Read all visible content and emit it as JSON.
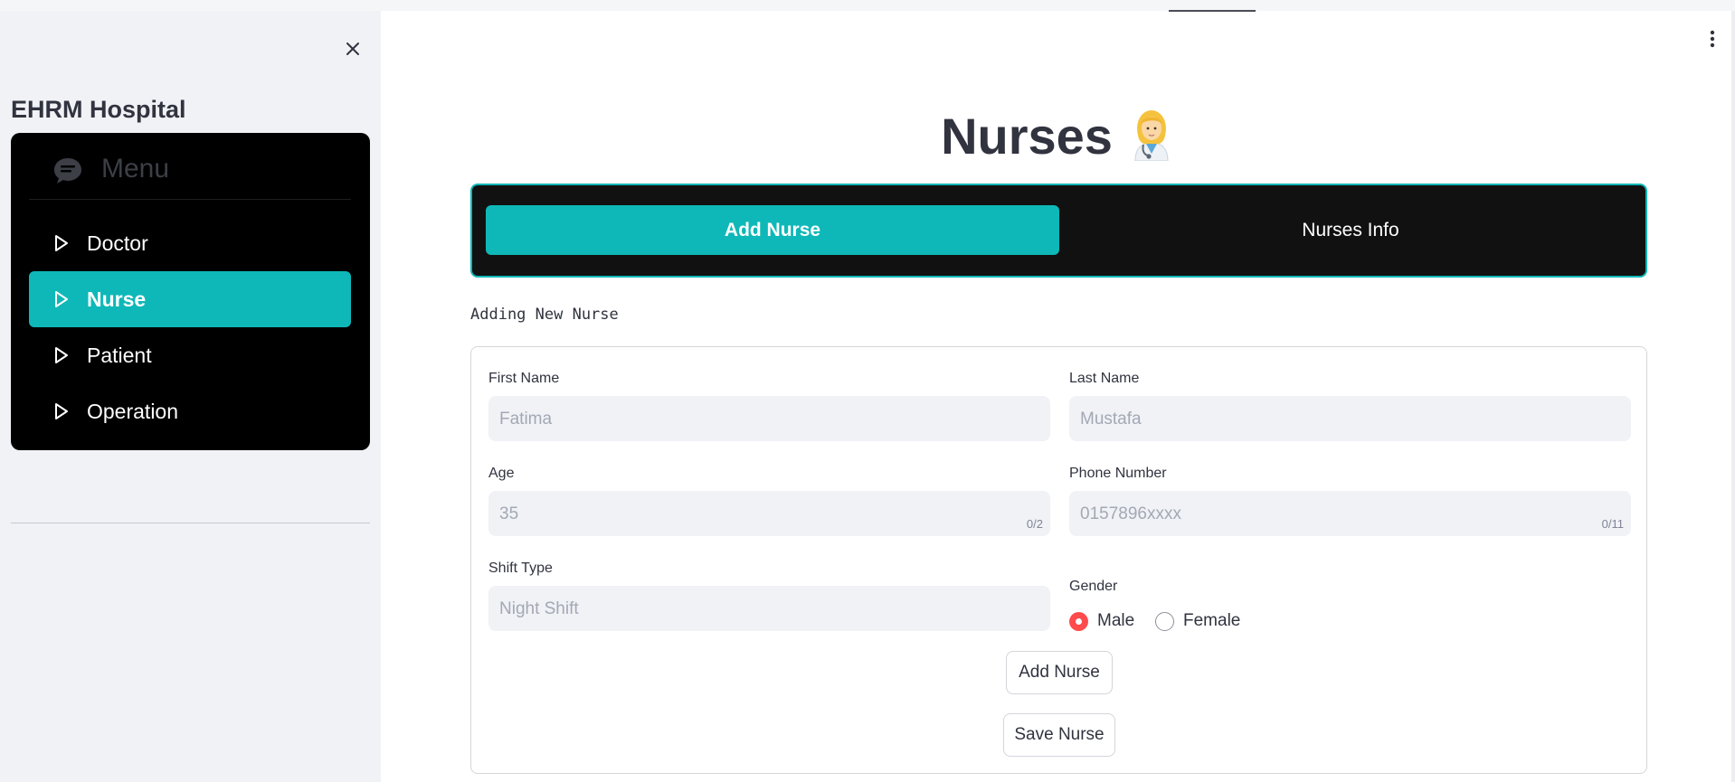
{
  "sidebar": {
    "title": "EHRM Hospital",
    "menu": {
      "header": "Menu",
      "items": [
        {
          "label": "Doctor"
        },
        {
          "label": "Nurse"
        },
        {
          "label": "Patient"
        },
        {
          "label": "Operation"
        }
      ],
      "active_item": "Nurse"
    }
  },
  "main": {
    "title": "Nurses",
    "title_emoji": "woman-health-worker",
    "tabs": [
      {
        "label": "Add Nurse"
      },
      {
        "label": "Nurses Info"
      }
    ],
    "active_tab": "Add Nurse",
    "subheading": "Adding New Nurse",
    "form": {
      "first_name": {
        "label": "First Name",
        "placeholder": "Fatima"
      },
      "last_name": {
        "label": "Last Name",
        "placeholder": "Mustafa"
      },
      "age": {
        "label": "Age",
        "placeholder": "35",
        "counter": "0/2"
      },
      "phone": {
        "label": "Phone Number",
        "placeholder": "0157896xxxx",
        "counter": "0/11"
      },
      "shift": {
        "label": "Shift Type",
        "placeholder": "Night Shift"
      },
      "gender": {
        "label": "Gender",
        "options": [
          "Male",
          "Female"
        ],
        "selected": "Male"
      },
      "add_button": "Add Nurse",
      "save_button": "Save Nurse"
    }
  },
  "colors": {
    "accent": "#0fb8b8",
    "radio_selected": "#ff4b4b",
    "sidebar_bg": "#f0f2f6",
    "menu_bg": "#000000"
  }
}
